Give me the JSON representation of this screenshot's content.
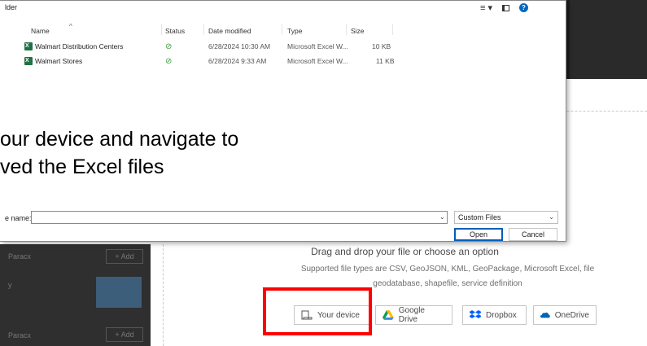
{
  "dialog": {
    "title": "lder",
    "columns": {
      "name": "Name",
      "status": "Status",
      "date": "Date modified",
      "type": "Type",
      "size": "Size"
    },
    "files": [
      {
        "name": "Walmart Distribution Centers",
        "status_icon": "synced-check-icon",
        "date": "6/28/2024 10:30 AM",
        "type": "Microsoft Excel W...",
        "size": "10 KB"
      },
      {
        "name": "Walmart Stores",
        "status_icon": "synced-check-icon",
        "date": "6/28/2024 9:33 AM",
        "type": "Microsoft Excel W...",
        "size": "11 KB"
      }
    ],
    "file_name_label": "e name:",
    "file_name_value": "",
    "filter_value": "Custom Files",
    "open_label": "Open",
    "cancel_label": "Cancel",
    "toolbar": {
      "view_icon": "≡ ▾",
      "help_icon": "?"
    }
  },
  "caption": {
    "line1": "our device and navigate to",
    "line2": "ved the Excel files"
  },
  "upload": {
    "drag_text": "Drag and drop your file or choose an option",
    "supported_text": "Supported file types are CSV, GeoJSON, KML, GeoPackage, Microsoft Excel, file geodatabase, shapefile, service definition",
    "sources": [
      {
        "label": "Your device",
        "icon": "device-icon"
      },
      {
        "label": "Google Drive",
        "icon": "google-drive-icon"
      },
      {
        "label": "Dropbox",
        "icon": "dropbox-icon"
      },
      {
        "label": "OneDrive",
        "icon": "onedrive-icon"
      }
    ]
  },
  "background": {
    "left_rows": [
      {
        "label": "Paracx",
        "add": "+ Add"
      },
      {
        "label": "y",
        "add": ""
      },
      {
        "label": "Paracx",
        "add": "+ Add"
      }
    ]
  },
  "colors": {
    "highlight": "#ff0000",
    "accent": "#0067c0",
    "excel": "#1f7244"
  }
}
